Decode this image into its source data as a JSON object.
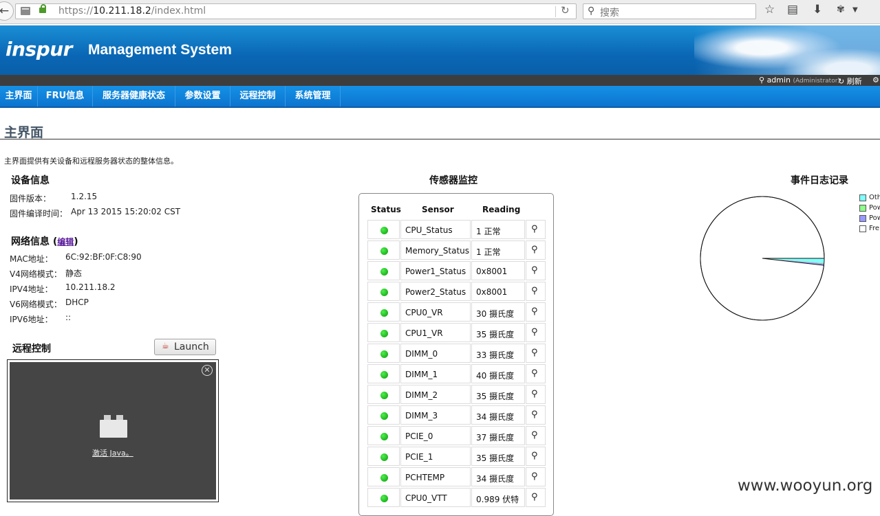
{
  "browser": {
    "url_scheme": "https://",
    "url_host": "10.211.18.2",
    "url_path": "/index.html",
    "search_placeholder": "搜索"
  },
  "header": {
    "logo": "inspur",
    "title": "Management System",
    "user": "admin",
    "role": "(Administrator)",
    "refresh": "刷新"
  },
  "nav": {
    "items": [
      "主界面",
      "FRU信息",
      "服务器健康状态",
      "参数设置",
      "远程控制",
      "系统管理"
    ]
  },
  "page": {
    "title": "主界面",
    "description": "主界面提供有关设备和远程服务器状态的整体信息。"
  },
  "device": {
    "heading": "设备信息",
    "fw_version_label": "固件版本：",
    "fw_version": "1.2.15",
    "fw_build_label": "固件编译时间：",
    "fw_build": "Apr 13 2015 15:20:02 CST"
  },
  "network": {
    "heading": "网络信息",
    "edit": "编辑",
    "mac_label": "MAC地址：",
    "mac": "6C:92:BF:0F:C8:90",
    "v4mode_label": "V4网络模式：",
    "v4mode": "静态",
    "ipv4_label": "IPV4地址：",
    "ipv4": "10.211.18.2",
    "v6mode_label": "V6网络模式：",
    "v6mode": "DHCP",
    "ipv6_label": "IPV6地址：",
    "ipv6": "::"
  },
  "remote": {
    "heading": "远程控制",
    "launch": "Launch",
    "activate_java": "激活 Java。"
  },
  "sensors": {
    "heading": "传感器监控",
    "col_status": "Status",
    "col_sensor": "Sensor",
    "col_reading": "Reading",
    "rows": [
      {
        "name": "CPU_Status",
        "reading": "1 正常"
      },
      {
        "name": "Memory_Status",
        "reading": "1 正常"
      },
      {
        "name": "Power1_Status",
        "reading": "0x8001"
      },
      {
        "name": "Power2_Status",
        "reading": "0x8001"
      },
      {
        "name": "CPU0_VR",
        "reading": "30 摄氏度"
      },
      {
        "name": "CPU1_VR",
        "reading": "35 摄氏度"
      },
      {
        "name": "DIMM_0",
        "reading": "33 摄氏度"
      },
      {
        "name": "DIMM_1",
        "reading": "40 摄氏度"
      },
      {
        "name": "DIMM_2",
        "reading": "35 摄氏度"
      },
      {
        "name": "DIMM_3",
        "reading": "34 摄氏度"
      },
      {
        "name": "PCIE_0",
        "reading": "37 摄氏度"
      },
      {
        "name": "PCIE_1",
        "reading": "35 摄氏度"
      },
      {
        "name": "PCHTEMP",
        "reading": "34 摄氏度"
      },
      {
        "name": "CPU0_VTT",
        "reading": "0.989 伏特"
      }
    ]
  },
  "event_log": {
    "heading": "事件日志记录",
    "legend": [
      {
        "label": "Oth",
        "color": "#7fffff"
      },
      {
        "label": "Pow",
        "color": "#8cff8c"
      },
      {
        "label": "Pow",
        "color": "#9999ff"
      },
      {
        "label": "Fre",
        "color": "#ffffff"
      }
    ],
    "pie_fractions": [
      0.011,
      0.002,
      0.005,
      0.982
    ]
  },
  "watermark": "www.wooyun.org"
}
